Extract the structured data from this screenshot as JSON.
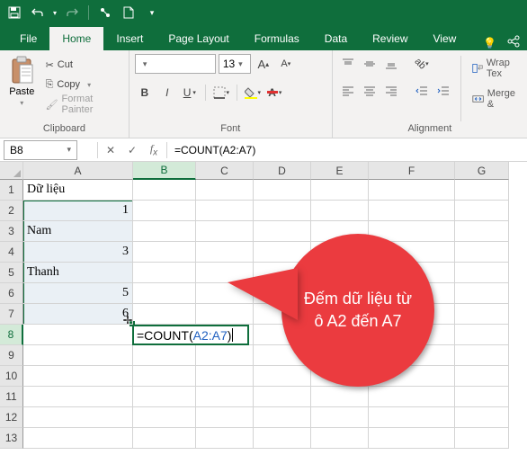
{
  "qat": {
    "save": "💾",
    "undo": "↶",
    "redo": "↷",
    "more": "▾"
  },
  "tabs": {
    "file": "File",
    "home": "Home",
    "insert": "Insert",
    "pageLayout": "Page Layout",
    "formulas": "Formulas",
    "data": "Data",
    "review": "Review",
    "view": "View"
  },
  "clipboard": {
    "group_label": "Clipboard",
    "paste": "Paste",
    "cut": "Cut",
    "copy": "Copy",
    "formatPainter": "Format Painter"
  },
  "font": {
    "group_label": "Font",
    "name": "",
    "size": "13",
    "grow": "A",
    "shrink": "A",
    "bold": "B",
    "italic": "I",
    "underline": "U"
  },
  "alignment": {
    "group_label": "Alignment",
    "wrap": "Wrap Tex",
    "merge": "Merge &"
  },
  "namebox": {
    "value": "B8"
  },
  "formulaBar": {
    "value": "=COUNT(A2:A7)"
  },
  "columns": [
    "A",
    "B",
    "C",
    "D",
    "E",
    "F",
    "G"
  ],
  "rows": [
    "1",
    "2",
    "3",
    "4",
    "5",
    "6",
    "7",
    "8",
    "9",
    "10",
    "11",
    "12",
    "13"
  ],
  "cells": {
    "A1": "Dữ liệu",
    "A2": "1",
    "A3": "Nam",
    "A4": "3",
    "A5": "Thanh",
    "A6": "5",
    "A7": "6"
  },
  "editing": {
    "prefix": "=COUNT(",
    "ref": "A2:A7",
    "suffix": ")"
  },
  "callout": {
    "text": "Đếm dữ liệu từ ô A2 đến A7"
  },
  "icons": {
    "scissors": "✂",
    "copy": "⎘",
    "brush": "🖌",
    "fx": "fx",
    "cancel": "✕",
    "enter": "✓",
    "shield": "🛡",
    "bulb": "💡",
    "share": "↗"
  }
}
